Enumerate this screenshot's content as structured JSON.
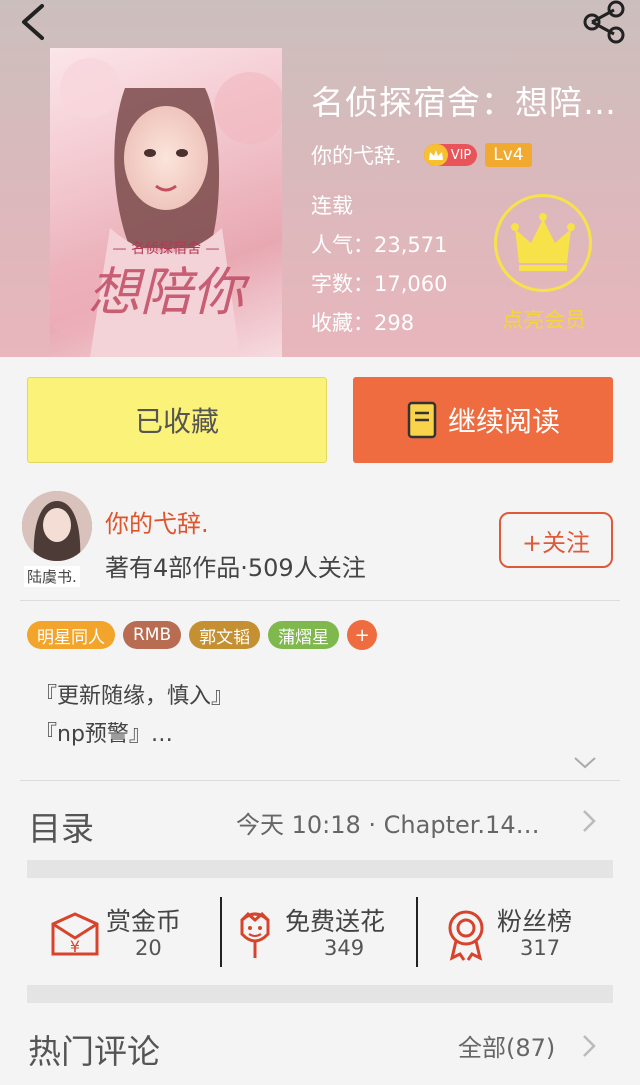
{
  "book": {
    "title": "名侦探宿舍：想陪…",
    "author": "你的弋辞.",
    "vip_label": "VIP",
    "level": "Lv4",
    "status": "连载",
    "popularity": "人气：23,571",
    "word_count": "字数：17,060",
    "favorites": "收藏：298",
    "vip_member_label": "点亮会员"
  },
  "actions": {
    "collected_label": "已收藏",
    "continue_label": "继续阅读"
  },
  "author_section": {
    "name": "你的弋辞.",
    "meta": "著有4部作品·509人关注",
    "follow_label": "+关注",
    "avatar_tag": "陆虞书."
  },
  "tags": [
    {
      "label": "明星同人",
      "color": "#f2a42b"
    },
    {
      "label": "RMB",
      "color": "#b86d53"
    },
    {
      "label": "郭文韬",
      "color": "#c59032"
    },
    {
      "label": "蒲熠星",
      "color": "#7fb84d"
    }
  ],
  "tag_add_label": "+",
  "description": {
    "line1": "『更新随缘，慎入』",
    "line2": "『np预警』…"
  },
  "catalog": {
    "title": "目录",
    "latest": "今天 10:18 · Chapter.14…"
  },
  "features": {
    "reward": {
      "label": "赏金币",
      "count": "20"
    },
    "flowers": {
      "label": "免费送花",
      "count": "349"
    },
    "fans": {
      "label": "粉丝榜",
      "count": "317"
    }
  },
  "comments": {
    "title": "热门评论",
    "all_label": "全部(87)"
  },
  "colors": {
    "accent": "#ee6c40",
    "collected": "#fbf27a",
    "icon_red": "#d8432c",
    "vip_gold": "#f7e24a"
  }
}
